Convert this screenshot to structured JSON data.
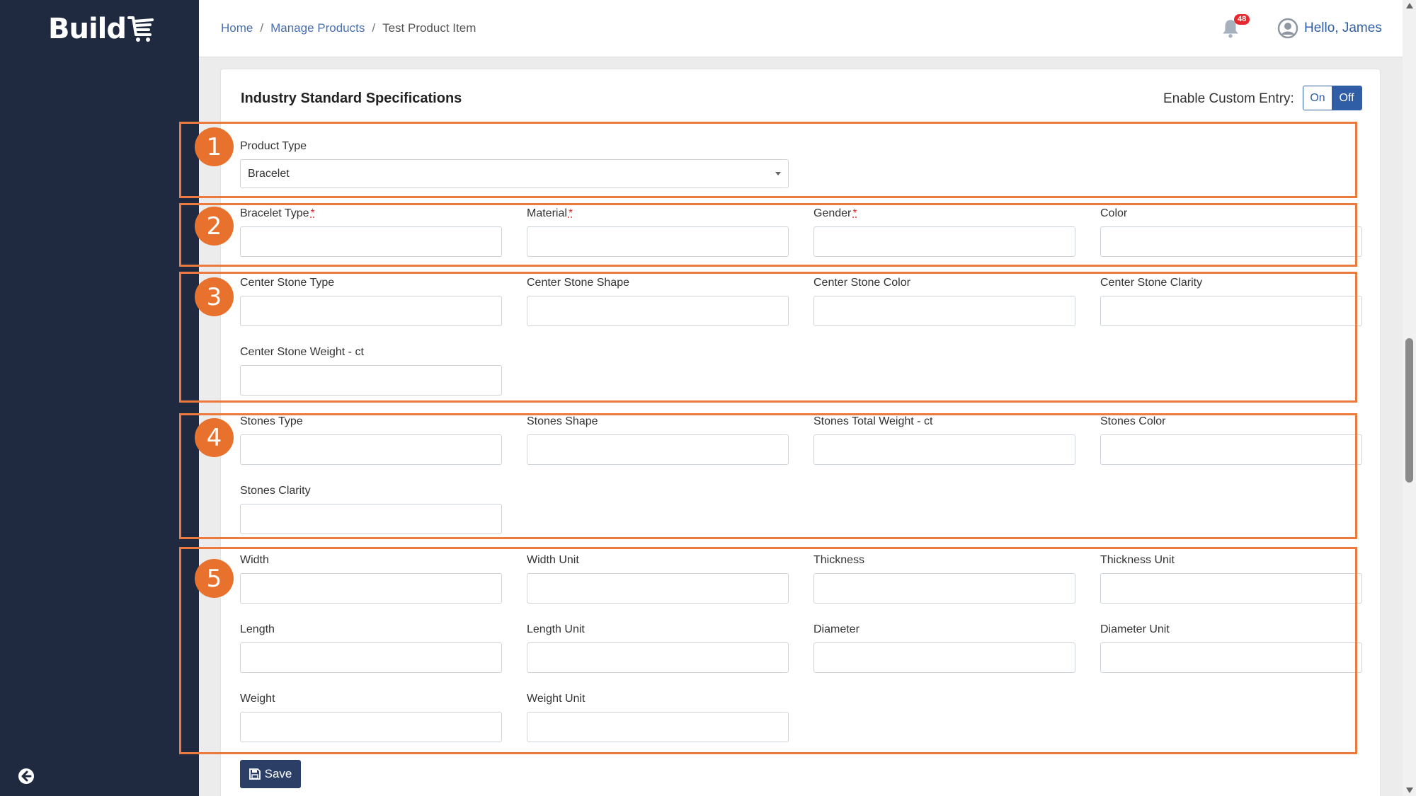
{
  "app": {
    "logo_text": "Build"
  },
  "header": {
    "breadcrumbs": [
      "Home",
      "Manage Products",
      "Test Product Item"
    ],
    "separator": "/",
    "notifications_count": "48",
    "greeting": "Hello, James"
  },
  "card": {
    "title": "Industry Standard Specifications",
    "custom_entry_label": "Enable Custom Entry:",
    "toggle_on": "On",
    "toggle_off": "Off",
    "toggle_selected": "Off"
  },
  "annotations": [
    "1",
    "2",
    "3",
    "4",
    "5"
  ],
  "fields": {
    "product_type": {
      "label": "Product Type",
      "value": "Bracelet"
    },
    "bracelet_type": {
      "label": "Bracelet Type",
      "required_mark": "*"
    },
    "material": {
      "label": "Material",
      "required_mark": "*"
    },
    "gender": {
      "label": "Gender",
      "required_mark": "*"
    },
    "color": {
      "label": "Color"
    },
    "center_stone_type": {
      "label": "Center Stone Type"
    },
    "center_stone_shape": {
      "label": "Center Stone Shape"
    },
    "center_stone_color": {
      "label": "Center Stone Color"
    },
    "center_stone_clarity": {
      "label": "Center Stone Clarity"
    },
    "center_stone_weight": {
      "label": "Center Stone Weight - ct"
    },
    "stones_type": {
      "label": "Stones Type"
    },
    "stones_shape": {
      "label": "Stones Shape"
    },
    "stones_total_weight": {
      "label": "Stones Total Weight - ct"
    },
    "stones_color": {
      "label": "Stones Color"
    },
    "stones_clarity": {
      "label": "Stones Clarity"
    },
    "width": {
      "label": "Width"
    },
    "width_unit": {
      "label": "Width Unit"
    },
    "thickness": {
      "label": "Thickness"
    },
    "thickness_unit": {
      "label": "Thickness Unit"
    },
    "length": {
      "label": "Length"
    },
    "length_unit": {
      "label": "Length Unit"
    },
    "diameter": {
      "label": "Diameter"
    },
    "diameter_unit": {
      "label": "Diameter Unit"
    },
    "weight": {
      "label": "Weight"
    },
    "weight_unit": {
      "label": "Weight Unit"
    }
  },
  "actions": {
    "save_label": "Save"
  },
  "colors": {
    "sidebar": "#1f2a40",
    "accent": "#2f5ea6",
    "annotation": "#e8722d",
    "save_button": "#2b3f66"
  }
}
